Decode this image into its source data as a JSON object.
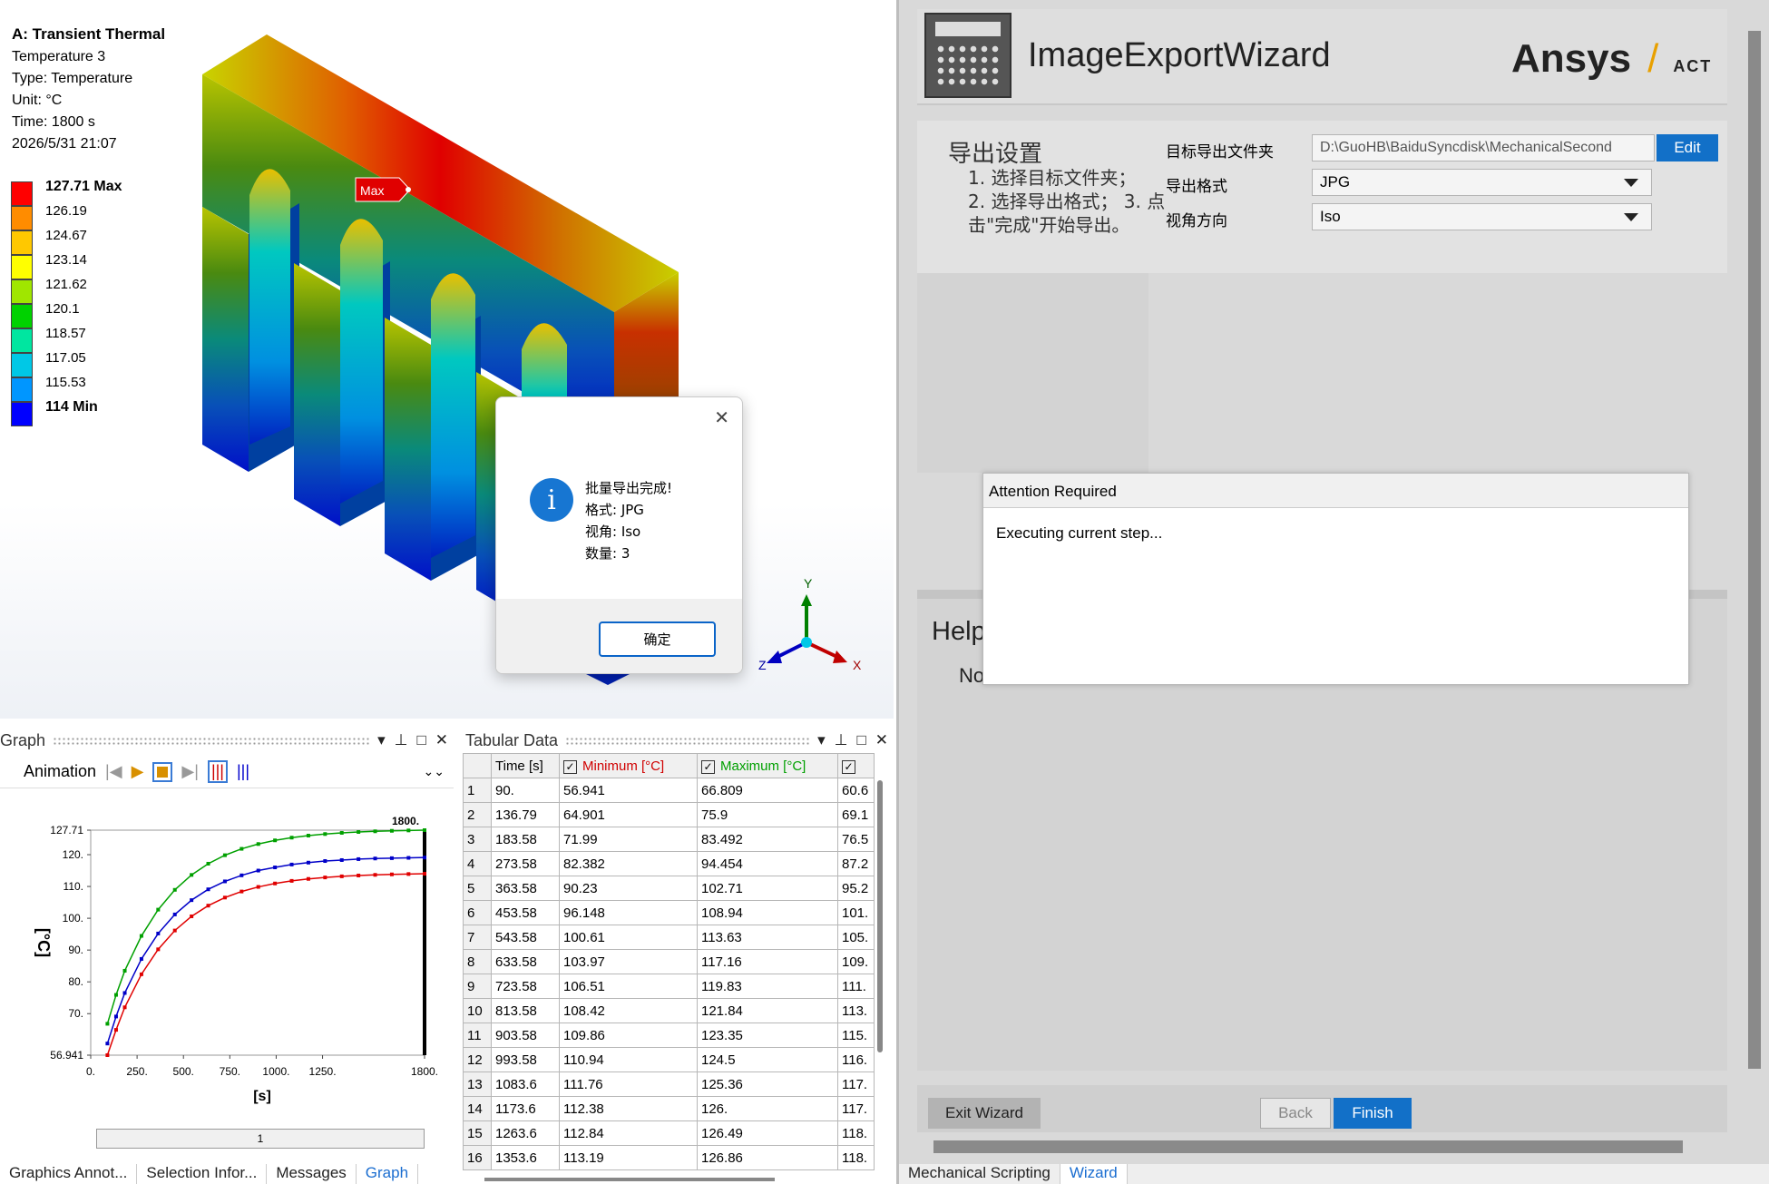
{
  "viewport": {
    "title": "A: Transient Thermal",
    "subtitle": "Temperature 3",
    "type_line": "Type: Temperature",
    "unit_line": "Unit: °C",
    "time_line": "Time: 1800 s",
    "date_line": "2026/5/31 21:07",
    "max_tag": "Max",
    "legend": [
      {
        "label": "127.71 Max",
        "color": "#ff0000",
        "bold": true
      },
      {
        "label": "126.19",
        "color": "#ff8c00"
      },
      {
        "label": "124.67",
        "color": "#ffc800"
      },
      {
        "label": "123.14",
        "color": "#ffff00"
      },
      {
        "label": "121.62",
        "color": "#a0e600"
      },
      {
        "label": "120.1",
        "color": "#00d200"
      },
      {
        "label": "118.57",
        "color": "#00e6a0"
      },
      {
        "label": "117.05",
        "color": "#00c8e6"
      },
      {
        "label": "115.53",
        "color": "#0096ff"
      },
      {
        "label": "114 Min",
        "color": "#0000ff",
        "bold": true
      }
    ],
    "triad": {
      "y": "Y",
      "x": "X",
      "z": "Z"
    }
  },
  "dialog": {
    "line1": "批量导出完成!",
    "line2": "格式: JPG",
    "line3": "视角: Iso",
    "line4": "数量: 3",
    "ok_label": "确定",
    "close_icon": "close-icon"
  },
  "graph_panel": {
    "title": "Graph",
    "animation_label": "Animation",
    "slider_value": "1",
    "chart_data": {
      "type": "line",
      "xlabel": "[s]",
      "ylabel": "[°C]",
      "time_marker": "1800.",
      "xlim": [
        0,
        1800
      ],
      "ylim": [
        56.941,
        127.71
      ],
      "x_ticks": [
        "0.",
        "250.",
        "500.",
        "750.",
        "1000.",
        "1250.",
        "1800."
      ],
      "y_ticks": [
        "127.71",
        "120.",
        "110.",
        "100.",
        "90.",
        "80.",
        "70.",
        "56.941"
      ],
      "x": [
        90,
        136.79,
        183.58,
        273.58,
        363.58,
        453.58,
        543.58,
        633.58,
        723.58,
        813.58,
        903.58,
        993.58,
        1083.6,
        1173.6,
        1263.6,
        1353.6,
        1443.6,
        1533.6,
        1623.6,
        1713.6,
        1800
      ],
      "series": [
        {
          "color": "#00a000",
          "values": [
            66.809,
            75.9,
            83.492,
            94.454,
            102.71,
            108.94,
            113.63,
            117.16,
            119.83,
            121.84,
            123.35,
            124.5,
            125.36,
            126.0,
            126.49,
            126.86,
            127.14,
            127.35,
            127.5,
            127.62,
            127.71
          ]
        },
        {
          "color": "#0000c8",
          "values": [
            60.6,
            69.1,
            76.5,
            87.2,
            95.2,
            101.2,
            105.7,
            109.1,
            111.6,
            113.5,
            115.0,
            116.0,
            116.9,
            117.5,
            118.0,
            118.3,
            118.6,
            118.8,
            118.9,
            119.0,
            119.1
          ]
        },
        {
          "color": "#e00000",
          "values": [
            56.941,
            64.901,
            71.99,
            82.382,
            90.23,
            96.148,
            100.61,
            103.97,
            106.51,
            108.42,
            109.86,
            110.94,
            111.76,
            112.38,
            112.84,
            113.19,
            113.45,
            113.65,
            113.8,
            113.91,
            114.0
          ]
        }
      ]
    }
  },
  "tabular_panel": {
    "title": "Tabular Data",
    "headers": [
      "Time [s]",
      "Minimum [°C]",
      "Maximum [°C]"
    ],
    "rows": [
      [
        "1",
        "90.",
        "56.941",
        "66.809",
        "60.6"
      ],
      [
        "2",
        "136.79",
        "64.901",
        "75.9",
        "69.1"
      ],
      [
        "3",
        "183.58",
        "71.99",
        "83.492",
        "76.5"
      ],
      [
        "4",
        "273.58",
        "82.382",
        "94.454",
        "87.2"
      ],
      [
        "5",
        "363.58",
        "90.23",
        "102.71",
        "95.2"
      ],
      [
        "6",
        "453.58",
        "96.148",
        "108.94",
        "101."
      ],
      [
        "7",
        "543.58",
        "100.61",
        "113.63",
        "105."
      ],
      [
        "8",
        "633.58",
        "103.97",
        "117.16",
        "109."
      ],
      [
        "9",
        "723.58",
        "106.51",
        "119.83",
        "111."
      ],
      [
        "10",
        "813.58",
        "108.42",
        "121.84",
        "113."
      ],
      [
        "11",
        "903.58",
        "109.86",
        "123.35",
        "115."
      ],
      [
        "12",
        "993.58",
        "110.94",
        "124.5",
        "116."
      ],
      [
        "13",
        "1083.6",
        "111.76",
        "125.36",
        "117."
      ],
      [
        "14",
        "1173.6",
        "112.38",
        "126.",
        "117."
      ],
      [
        "15",
        "1263.6",
        "112.84",
        "126.49",
        "118."
      ],
      [
        "16",
        "1353.6",
        "113.19",
        "126.86",
        "118."
      ]
    ]
  },
  "bottom_tabs_left": [
    "Graphics Annot...",
    "Selection Infor...",
    "Messages",
    "Graph"
  ],
  "wizard": {
    "title": "ImageExportWizard",
    "brand": "Ansys",
    "brand_suffix": "ACT",
    "section_title": "导出设置",
    "steps": "1. 选择目标文件夹；\n2. 选择导出格式； 3. 点击\"完成\"开始导出。",
    "folder_label": "目标导出文件夹",
    "folder_value": "D:\\GuoHB\\BaiduSyncdisk\\MechanicalSecond",
    "edit_label": "Edit",
    "format_label": "导出格式",
    "format_value": "JPG",
    "view_label": "视角方向",
    "view_value": "Iso",
    "help_title": "Help",
    "help_text": "No",
    "attention_title": "Attention Required",
    "attention_msg": "Executing current step...",
    "exit_label": "Exit Wizard",
    "back_label": "Back",
    "finish_label": "Finish",
    "tabs": [
      "Mechanical Scripting",
      "Wizard"
    ]
  }
}
